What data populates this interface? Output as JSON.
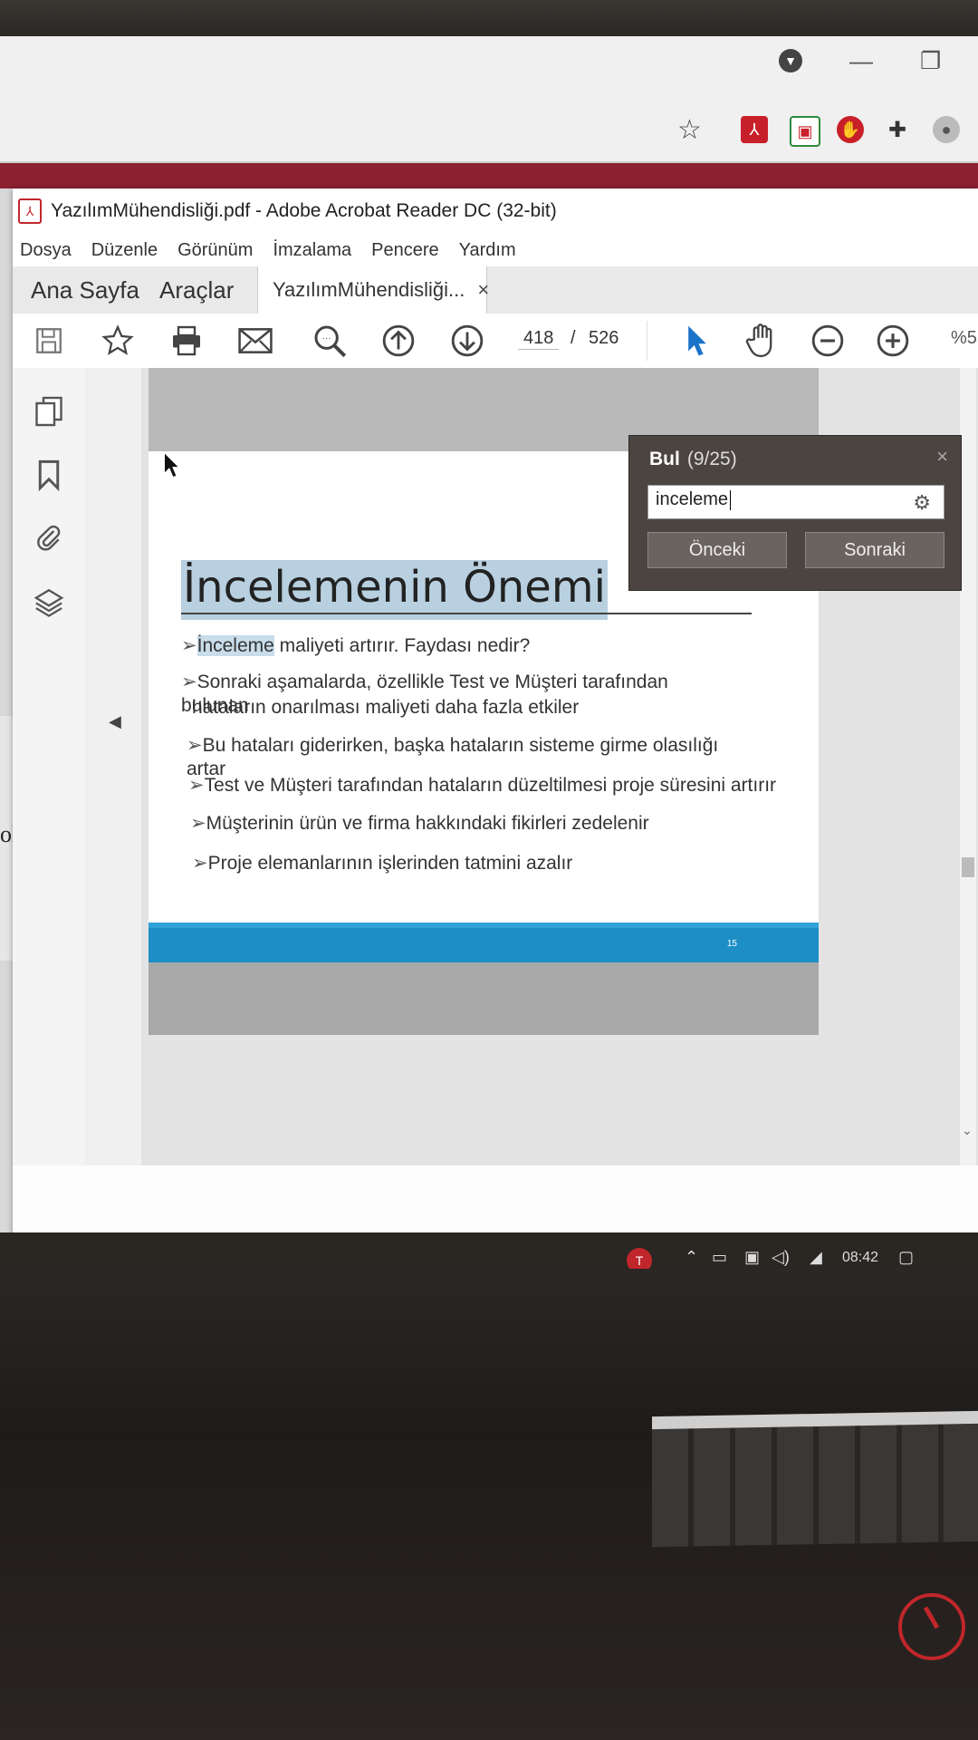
{
  "acrobat": {
    "window_title": "YazılımMühendisliği.pdf - Adobe Acrobat Reader DC (32-bit)",
    "menu": [
      "Dosya",
      "Düzenle",
      "Görünüm",
      "İmzalama",
      "Pencere",
      "Yardım"
    ],
    "tabs": {
      "home": "Ana Sayfa",
      "tools": "Araçlar",
      "document": "YazılımMühendisliği...",
      "document_close": "×"
    },
    "toolbar": {
      "current_page": "418",
      "separator": "/",
      "total_pages": "526",
      "zoom": "%5"
    }
  },
  "find": {
    "title": "Bul",
    "count": "(9/25)",
    "close": "×",
    "query": "inceleme",
    "prev_label": "Önceki",
    "next_label": "Sonraki"
  },
  "slide": {
    "title": "İncelemenin Önemi",
    "bullets": [
      {
        "highlight": "İnceleme",
        "text": " maliyeti artırır. Faydası nedir?"
      },
      {
        "highlight": "",
        "text": "Sonraki aşamalarda, özellikle Test ve Müşteri tarafından bulunan"
      },
      {
        "highlight": "",
        "text": "hataların onarılması maliyeti daha fazla etkiler"
      },
      {
        "highlight": "",
        "text": "Bu hataları giderirken, başka hataların sisteme girme olasılığı artar"
      },
      {
        "highlight": "",
        "text": "Test ve Müşteri tarafından hataların düzeltilmesi proje süresini artırır"
      },
      {
        "highlight": "",
        "text": "Müşterinin ürün ve firma hakkındaki fikirleri zedelenir"
      },
      {
        "highlight": "",
        "text": "Proje elemanlarının işlerinden tatmini azalır"
      }
    ],
    "page_number": "15"
  },
  "background": {
    "page_fragment": "olur"
  },
  "taskbar": {
    "time": "08:42"
  },
  "colors": {
    "find_bg": "#4b4441",
    "slide_blue_bar": "#1e8fc6",
    "search_highlight": "#b8d0e0",
    "chrome_maroon": "#8d2130"
  }
}
